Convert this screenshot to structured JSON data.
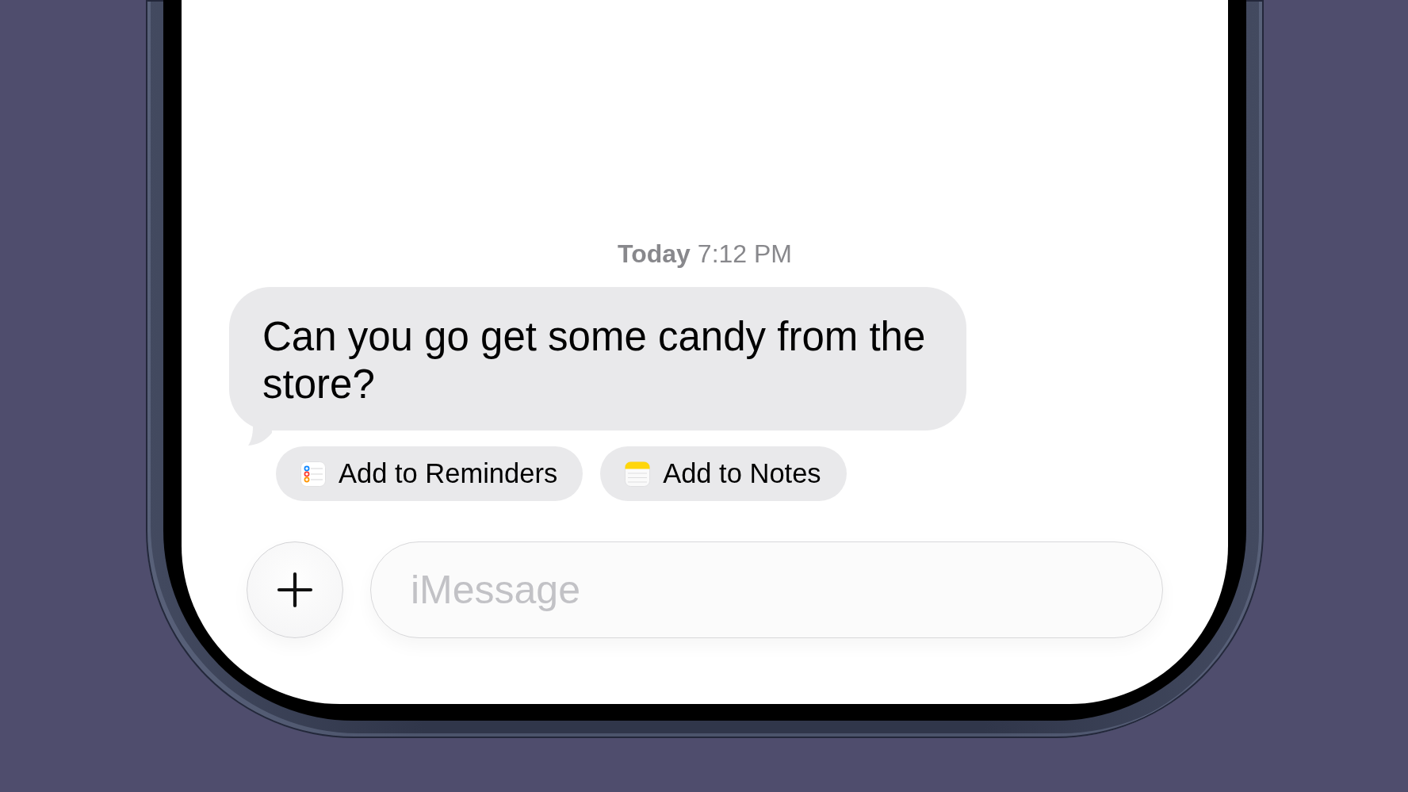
{
  "timestamp": {
    "day": "Today",
    "time": "7:12 PM"
  },
  "messages": [
    {
      "kind": "received",
      "text": "Can you go get some candy from the store?"
    }
  ],
  "suggestions": [
    {
      "kind": "reminders",
      "label": "Add to Reminders"
    },
    {
      "kind": "notes",
      "label": "Add to Notes"
    }
  ],
  "composer": {
    "placeholder": "iMessage"
  }
}
